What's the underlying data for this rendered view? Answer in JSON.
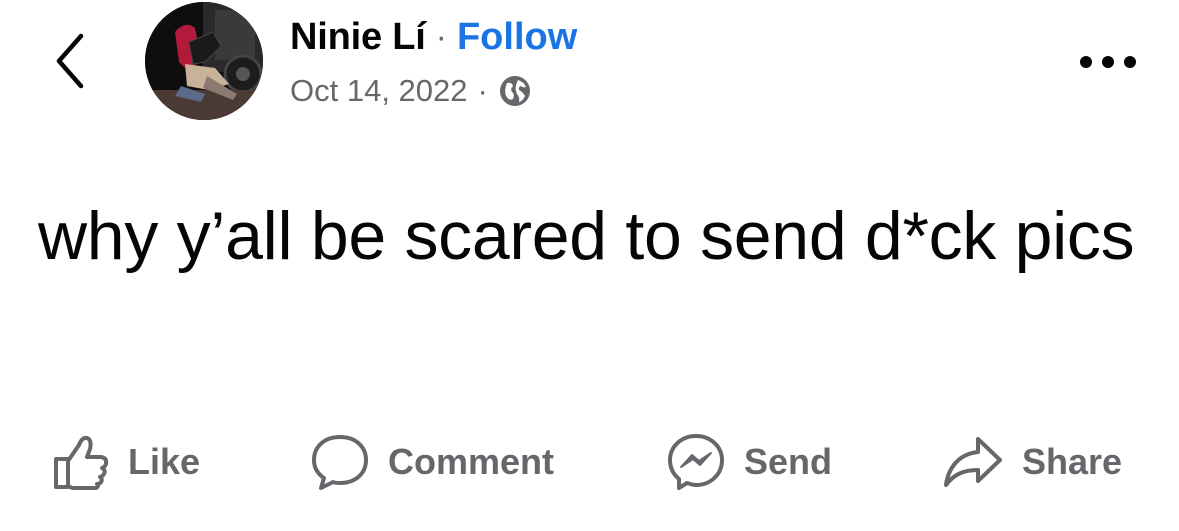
{
  "header": {
    "back_icon": "chevron-left-icon",
    "author_name": "Ninie Lí",
    "separator": "·",
    "follow_label": "Follow",
    "timestamp": "Oct 14, 2022",
    "meta_separator": "·",
    "privacy_icon": "globe-icon",
    "more_icon": "more-horizontal-icon"
  },
  "post": {
    "text": "why y’all be scared to send d*ck pics"
  },
  "actions": {
    "like": {
      "label": "Like",
      "icon": "thumbs-up-icon"
    },
    "comment": {
      "label": "Comment",
      "icon": "comment-bubble-icon"
    },
    "send": {
      "label": "Send",
      "icon": "messenger-icon"
    },
    "share": {
      "label": "Share",
      "icon": "share-arrow-icon"
    }
  },
  "colors": {
    "text": "#050505",
    "secondary": "#65676b",
    "link": "#1b74e4",
    "background": "#ffffff"
  }
}
